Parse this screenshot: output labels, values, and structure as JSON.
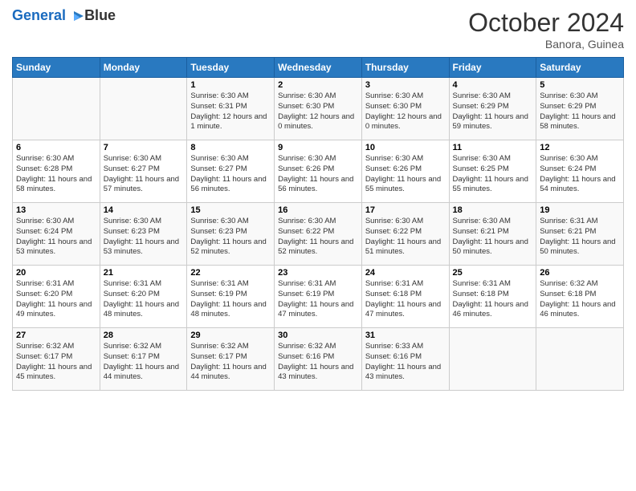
{
  "logo": {
    "line1": "General",
    "line2": "Blue"
  },
  "title": "October 2024",
  "subtitle": "Banora, Guinea",
  "days_header": [
    "Sunday",
    "Monday",
    "Tuesday",
    "Wednesday",
    "Thursday",
    "Friday",
    "Saturday"
  ],
  "weeks": [
    [
      {
        "day": "",
        "content": ""
      },
      {
        "day": "",
        "content": ""
      },
      {
        "day": "1",
        "content": "Sunrise: 6:30 AM\nSunset: 6:31 PM\nDaylight: 12 hours and 1 minute."
      },
      {
        "day": "2",
        "content": "Sunrise: 6:30 AM\nSunset: 6:30 PM\nDaylight: 12 hours and 0 minutes."
      },
      {
        "day": "3",
        "content": "Sunrise: 6:30 AM\nSunset: 6:30 PM\nDaylight: 12 hours and 0 minutes."
      },
      {
        "day": "4",
        "content": "Sunrise: 6:30 AM\nSunset: 6:29 PM\nDaylight: 11 hours and 59 minutes."
      },
      {
        "day": "5",
        "content": "Sunrise: 6:30 AM\nSunset: 6:29 PM\nDaylight: 11 hours and 58 minutes."
      }
    ],
    [
      {
        "day": "6",
        "content": "Sunrise: 6:30 AM\nSunset: 6:28 PM\nDaylight: 11 hours and 58 minutes."
      },
      {
        "day": "7",
        "content": "Sunrise: 6:30 AM\nSunset: 6:27 PM\nDaylight: 11 hours and 57 minutes."
      },
      {
        "day": "8",
        "content": "Sunrise: 6:30 AM\nSunset: 6:27 PM\nDaylight: 11 hours and 56 minutes."
      },
      {
        "day": "9",
        "content": "Sunrise: 6:30 AM\nSunset: 6:26 PM\nDaylight: 11 hours and 56 minutes."
      },
      {
        "day": "10",
        "content": "Sunrise: 6:30 AM\nSunset: 6:26 PM\nDaylight: 11 hours and 55 minutes."
      },
      {
        "day": "11",
        "content": "Sunrise: 6:30 AM\nSunset: 6:25 PM\nDaylight: 11 hours and 55 minutes."
      },
      {
        "day": "12",
        "content": "Sunrise: 6:30 AM\nSunset: 6:24 PM\nDaylight: 11 hours and 54 minutes."
      }
    ],
    [
      {
        "day": "13",
        "content": "Sunrise: 6:30 AM\nSunset: 6:24 PM\nDaylight: 11 hours and 53 minutes."
      },
      {
        "day": "14",
        "content": "Sunrise: 6:30 AM\nSunset: 6:23 PM\nDaylight: 11 hours and 53 minutes."
      },
      {
        "day": "15",
        "content": "Sunrise: 6:30 AM\nSunset: 6:23 PM\nDaylight: 11 hours and 52 minutes."
      },
      {
        "day": "16",
        "content": "Sunrise: 6:30 AM\nSunset: 6:22 PM\nDaylight: 11 hours and 52 minutes."
      },
      {
        "day": "17",
        "content": "Sunrise: 6:30 AM\nSunset: 6:22 PM\nDaylight: 11 hours and 51 minutes."
      },
      {
        "day": "18",
        "content": "Sunrise: 6:30 AM\nSunset: 6:21 PM\nDaylight: 11 hours and 50 minutes."
      },
      {
        "day": "19",
        "content": "Sunrise: 6:31 AM\nSunset: 6:21 PM\nDaylight: 11 hours and 50 minutes."
      }
    ],
    [
      {
        "day": "20",
        "content": "Sunrise: 6:31 AM\nSunset: 6:20 PM\nDaylight: 11 hours and 49 minutes."
      },
      {
        "day": "21",
        "content": "Sunrise: 6:31 AM\nSunset: 6:20 PM\nDaylight: 11 hours and 48 minutes."
      },
      {
        "day": "22",
        "content": "Sunrise: 6:31 AM\nSunset: 6:19 PM\nDaylight: 11 hours and 48 minutes."
      },
      {
        "day": "23",
        "content": "Sunrise: 6:31 AM\nSunset: 6:19 PM\nDaylight: 11 hours and 47 minutes."
      },
      {
        "day": "24",
        "content": "Sunrise: 6:31 AM\nSunset: 6:18 PM\nDaylight: 11 hours and 47 minutes."
      },
      {
        "day": "25",
        "content": "Sunrise: 6:31 AM\nSunset: 6:18 PM\nDaylight: 11 hours and 46 minutes."
      },
      {
        "day": "26",
        "content": "Sunrise: 6:32 AM\nSunset: 6:18 PM\nDaylight: 11 hours and 46 minutes."
      }
    ],
    [
      {
        "day": "27",
        "content": "Sunrise: 6:32 AM\nSunset: 6:17 PM\nDaylight: 11 hours and 45 minutes."
      },
      {
        "day": "28",
        "content": "Sunrise: 6:32 AM\nSunset: 6:17 PM\nDaylight: 11 hours and 44 minutes."
      },
      {
        "day": "29",
        "content": "Sunrise: 6:32 AM\nSunset: 6:17 PM\nDaylight: 11 hours and 44 minutes."
      },
      {
        "day": "30",
        "content": "Sunrise: 6:32 AM\nSunset: 6:16 PM\nDaylight: 11 hours and 43 minutes."
      },
      {
        "day": "31",
        "content": "Sunrise: 6:33 AM\nSunset: 6:16 PM\nDaylight: 11 hours and 43 minutes."
      },
      {
        "day": "",
        "content": ""
      },
      {
        "day": "",
        "content": ""
      }
    ]
  ]
}
